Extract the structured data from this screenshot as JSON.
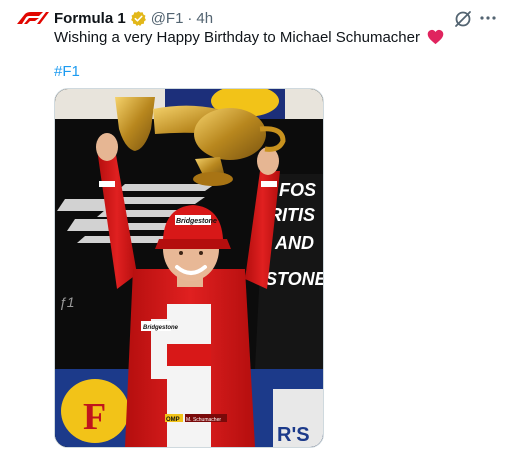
{
  "tweet": {
    "author_name": "Formula 1",
    "handle": "@F1",
    "separator": "·",
    "time": "4h",
    "text": "Wishing a very Happy Birthday to Michael Schumacher",
    "hashtag": "#F1"
  },
  "icons": {
    "avatar": "f1-logo-icon",
    "verified": "verified-badge-icon",
    "grok": "grok-icon",
    "more": "more-icon",
    "heart": "heart-icon"
  },
  "colors": {
    "f1_red": "#e10600",
    "verified_gold": "#e2b719",
    "hashtag": "#1d9bf0",
    "muted": "#536471"
  },
  "media": {
    "backdrop_text": [
      "FOS",
      "RITIS",
      "AND",
      "STONE",
      "R'S"
    ],
    "sponsor_text": "Bridgestone",
    "patch_text": "OMP",
    "name_strip": "M. Schumacher"
  }
}
